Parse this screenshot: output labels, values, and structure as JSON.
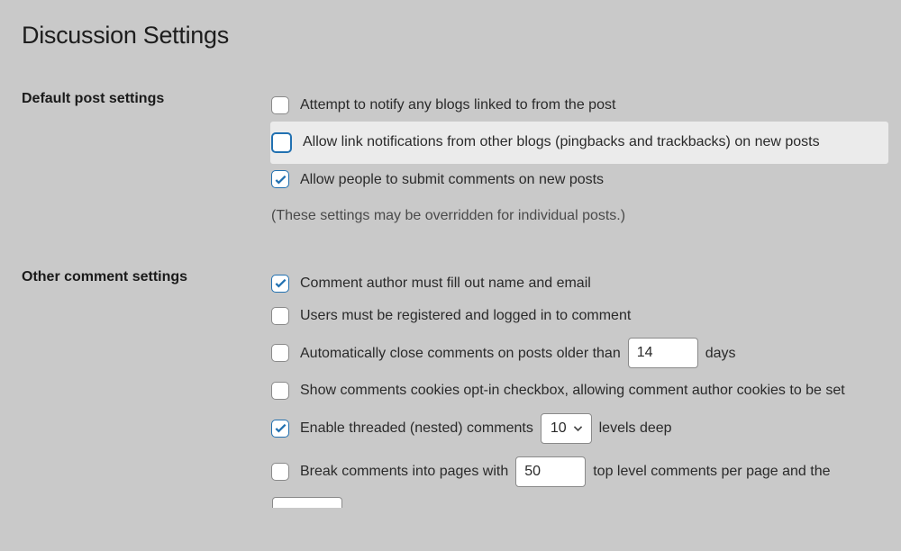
{
  "page": {
    "title": "Discussion Settings"
  },
  "sections": {
    "default_post": {
      "label": "Default post settings",
      "options": {
        "notify_linked": "Attempt to notify any blogs linked to from the post",
        "allow_pingbacks": "Allow link notifications from other blogs (pingbacks and trackbacks) on new posts",
        "allow_comments": "Allow people to submit comments on new posts"
      },
      "note": "(These settings may be overridden for individual posts.)"
    },
    "other_comment": {
      "label": "Other comment settings",
      "options": {
        "require_name_email": "Comment author must fill out name and email",
        "require_registration": "Users must be registered and logged in to comment",
        "auto_close_prefix": "Automatically close comments on posts older than",
        "auto_close_value": "14",
        "auto_close_suffix": "days",
        "show_cookies_optin": "Show comments cookies opt-in checkbox, allowing comment author cookies to be set",
        "threaded_prefix": "Enable threaded (nested) comments",
        "threaded_value": "10",
        "threaded_suffix": "levels deep",
        "paginate_prefix": "Break comments into pages with",
        "paginate_value": "50",
        "paginate_suffix": "top level comments per page and the"
      }
    }
  }
}
